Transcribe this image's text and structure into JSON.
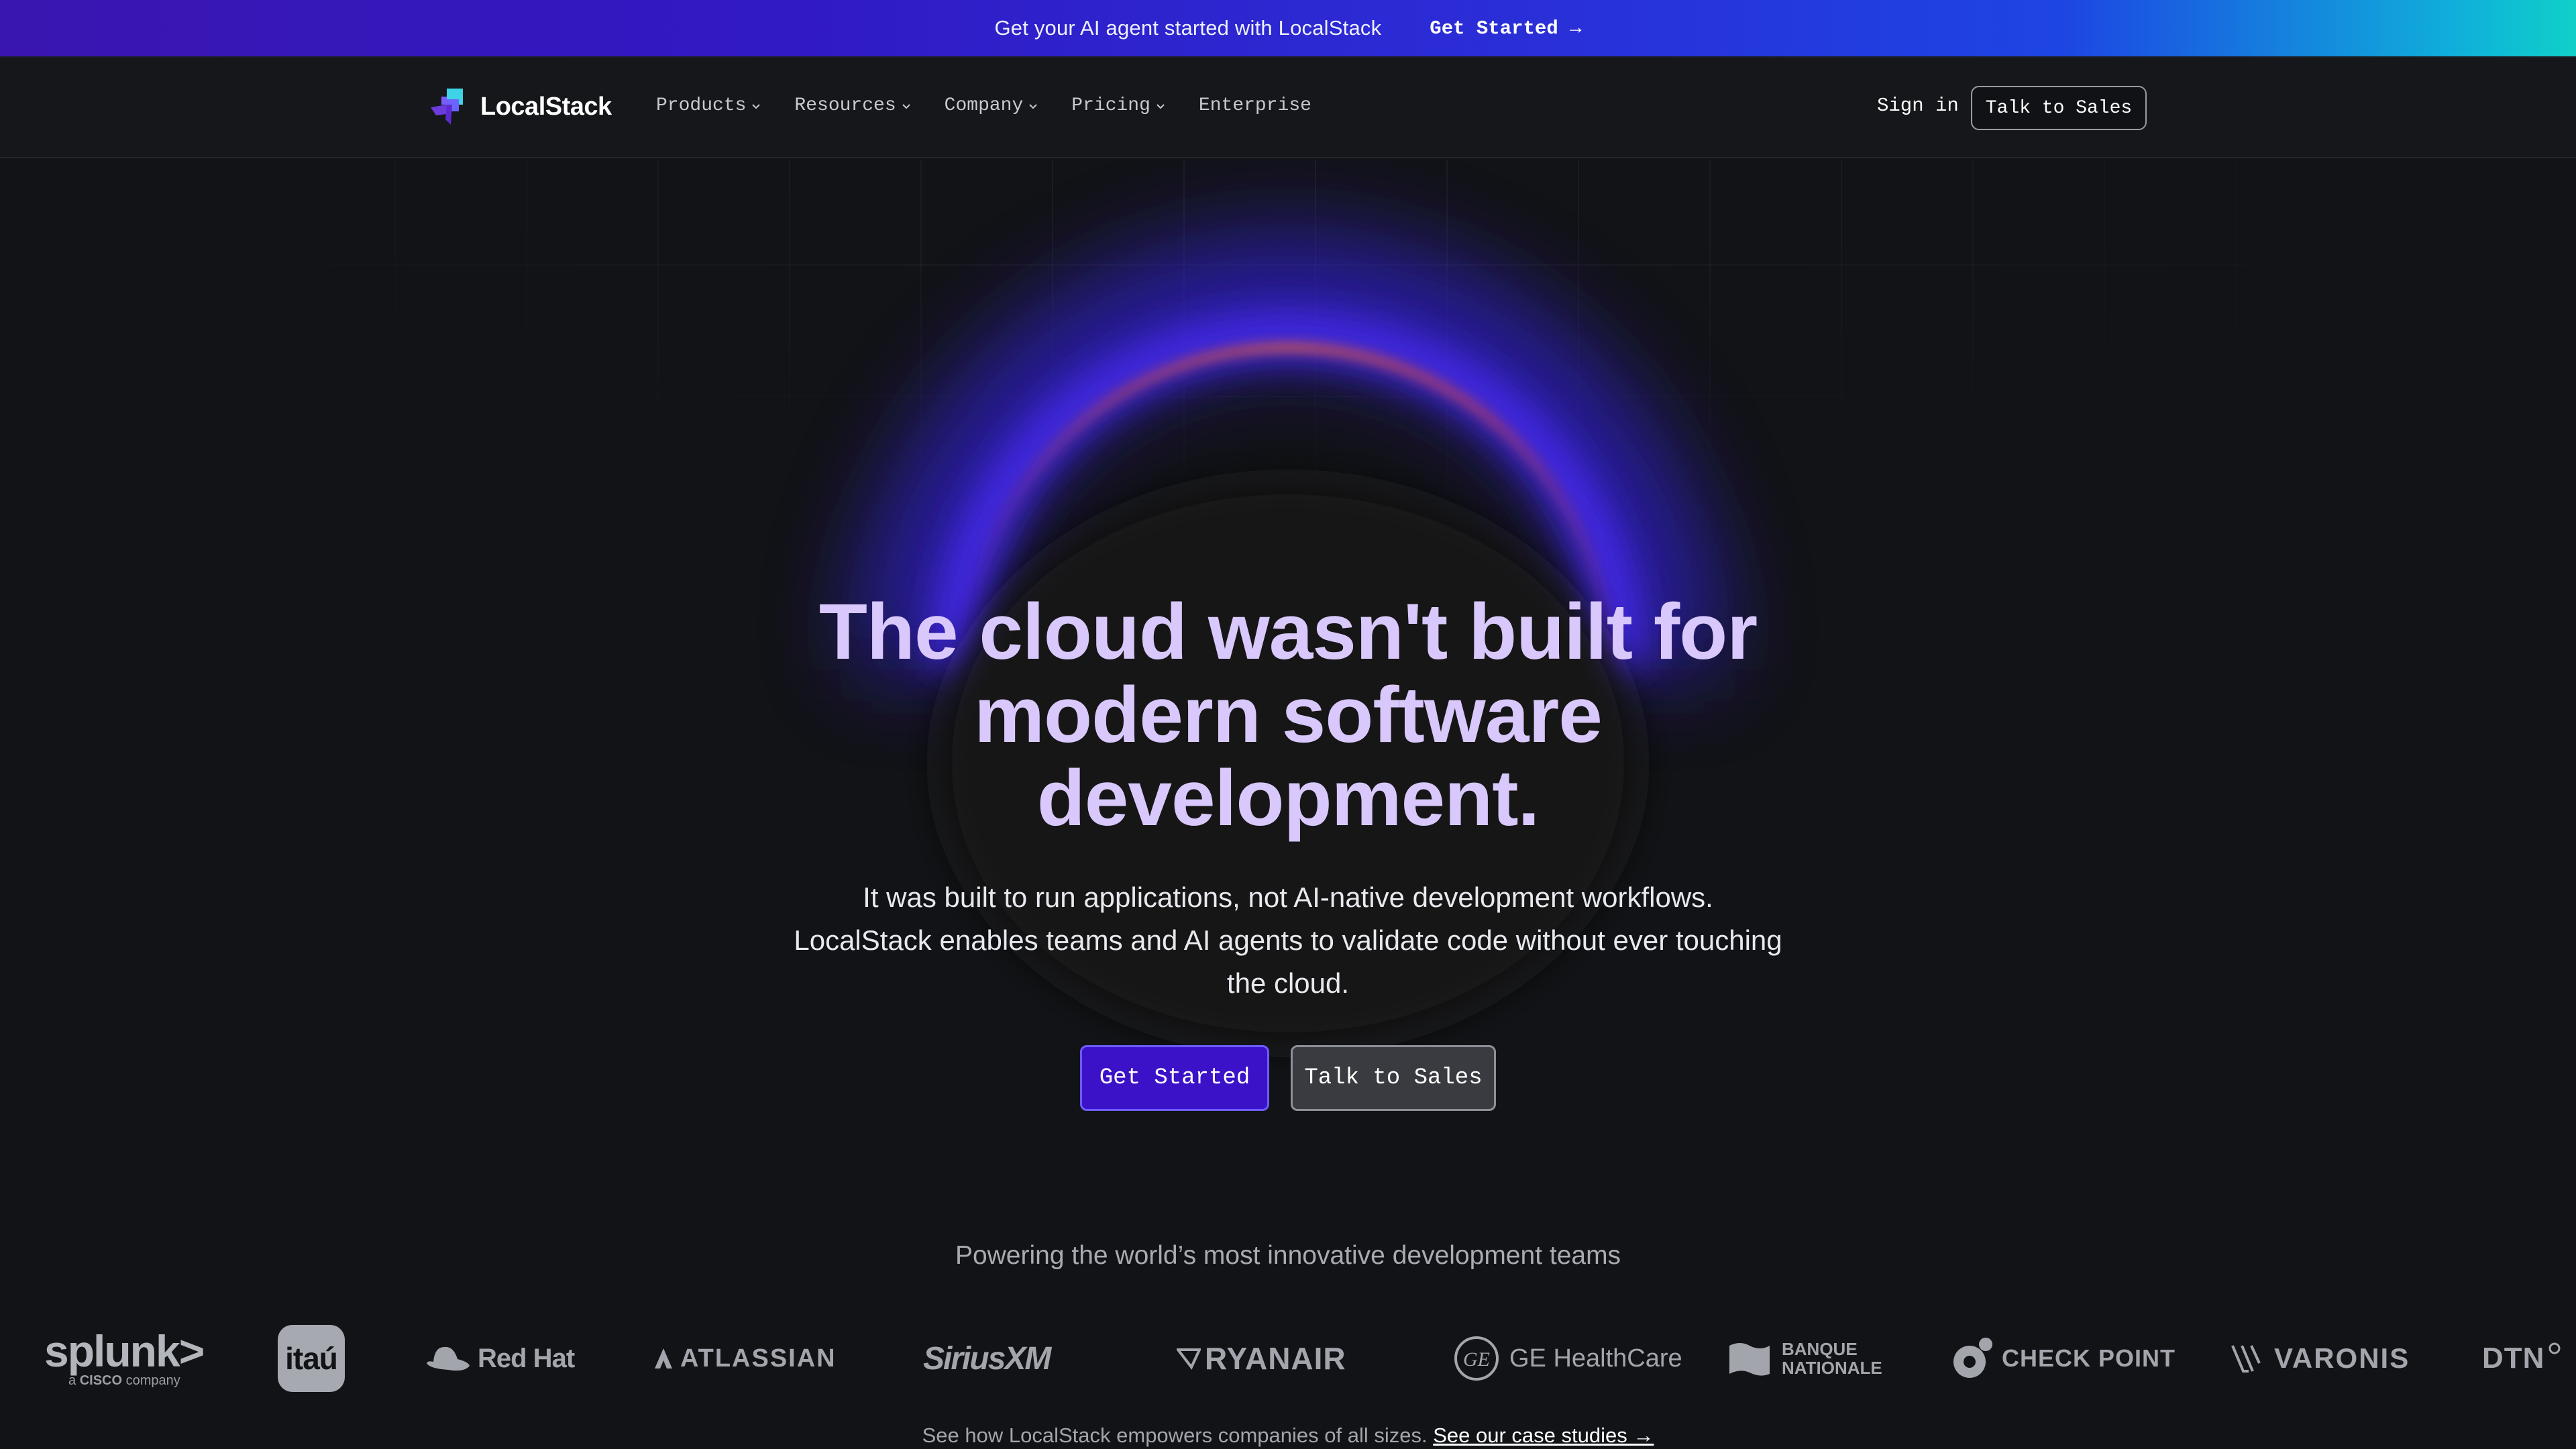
{
  "announcement": {
    "text": "Get your AI agent started with LocalStack",
    "cta_label": "Get Started →"
  },
  "nav": {
    "brand": "LocalStack",
    "items": [
      {
        "label": "Products",
        "has_dropdown": true
      },
      {
        "label": "Resources",
        "has_dropdown": true
      },
      {
        "label": "Company",
        "has_dropdown": true
      },
      {
        "label": "Pricing",
        "has_dropdown": true
      },
      {
        "label": "Enterprise",
        "has_dropdown": false
      }
    ],
    "signin_label": "Sign in",
    "sales_label": "Talk to Sales"
  },
  "hero": {
    "headline": "The cloud wasn't built for modern software development.",
    "subheadline": "It was built to run applications, not AI-native development workflows. LocalStack enables teams and AI agents to validate code without ever touching the cloud.",
    "primary_cta": "Get Started",
    "secondary_cta": "Talk to Sales"
  },
  "logos_section": {
    "heading": "Powering the world’s most innovative development teams",
    "logos": {
      "splunk": {
        "name": "splunk>",
        "tagline_prefix": "a",
        "tagline_brand": "CISCO",
        "tagline_suffix": "company"
      },
      "itau": "itaú",
      "redhat": "Red Hat",
      "atlassian": "ATLASSIAN",
      "siriusxm": "SiriusXM",
      "ryanair": "RYANAIR",
      "ge": "GE HealthCare",
      "banque_line1": "BANQUE",
      "banque_line2": "NATIONALE",
      "checkpoint": "CHECK POINT",
      "varonis": "VARONIS",
      "dtn": "DTN"
    },
    "case_text": "See how LocalStack empowers companies of all sizes.",
    "case_link": "See our case studies →"
  },
  "colors": {
    "accent": "#3b12c8",
    "headline": "#d9c8fb",
    "background": "#121316"
  }
}
